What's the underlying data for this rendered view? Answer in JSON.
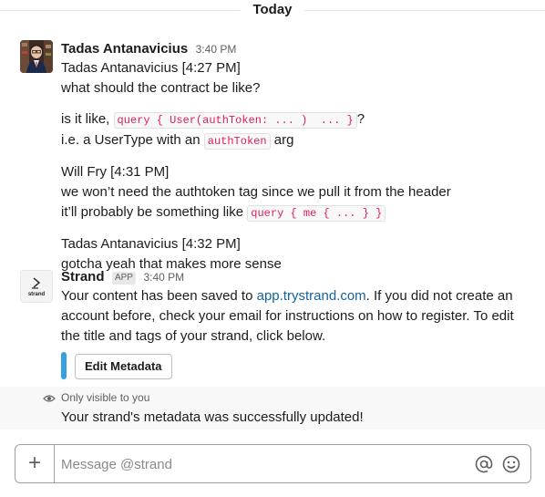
{
  "divider": {
    "label": "Today"
  },
  "messages": [
    {
      "sender": "Tadas Antanavicius",
      "time": "3:40 PM",
      "lines": [
        "Tadas Antanavicius [4:27 PM]",
        "what should the contract be like?"
      ],
      "question": {
        "prefix": "is it like, ",
        "code": "query { User(authToken: ... )  ... }",
        "suffix": "?"
      },
      "clarify": {
        "prefix": "i.e. a UserType with an ",
        "code": "authToken",
        "suffix": " arg"
      },
      "reply_header": "Will Fry [4:31 PM]",
      "reply_line": "we won’t need the authtoken tag since we pull it from the header",
      "reply_code_line": {
        "prefix": "it’ll probably be something like ",
        "code": "query { me { ... } }"
      },
      "followup_header": "Tadas Antanavicius [4:32 PM]",
      "followup_line": "gotcha yeah that makes more sense"
    },
    {
      "sender": "Strand",
      "badge": "APP",
      "time": "3:40 PM",
      "avatar_label": "strand",
      "text_prefix": "Your content has been saved to ",
      "link": "app.trystrand.com",
      "text_line1_suffix": ". If you did not create an",
      "text_line2": "account before, check your email for instructions on how to register. To edit",
      "text_line3": "the title and tags of your strand, click below.",
      "button_label": "Edit Metadata"
    }
  ],
  "ephemeral": {
    "note": "Only visible to you",
    "text": "Your strand's metadata was successfully updated!"
  },
  "composer": {
    "placeholder": "Message @strand"
  },
  "icons": {
    "plus": "plus-icon",
    "mention": "at-sign-icon",
    "emoji": "emoji-icon",
    "eye": "eye-icon"
  },
  "colors": {
    "code_text": "#e01e5a",
    "link": "#1264a3",
    "attachment_bar": "#36a0e0"
  }
}
